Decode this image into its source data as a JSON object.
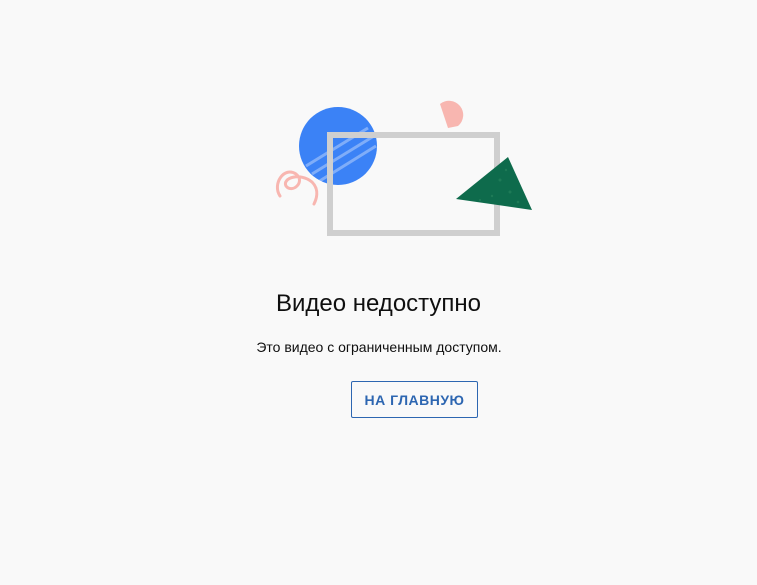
{
  "error": {
    "title": "Видео недоступно",
    "message": "Это видео с ограниченным доступом.",
    "home_button_label": "НА ГЛАВНУЮ"
  },
  "illustration": {
    "name": "video-unavailable-illustration",
    "colors": {
      "blue_circle": "#3b82f6",
      "gray_frame": "#cfcfcf",
      "green_triangle": "#0e6b4c",
      "pink_accent": "#f8b6b0"
    }
  },
  "theme": {
    "background": "#f9f9f9",
    "text": "#0f0f0f",
    "accent": "#2d66b1"
  }
}
